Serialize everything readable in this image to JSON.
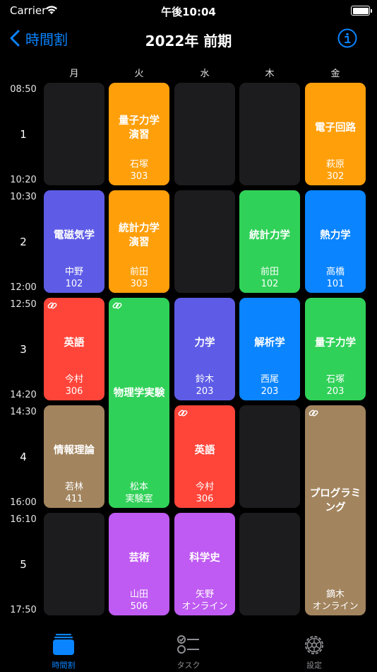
{
  "status": {
    "carrier": "Carrier",
    "time": "午後10:04"
  },
  "nav": {
    "back_label": "時間割",
    "title": "2022年 前期"
  },
  "days": [
    "月",
    "火",
    "水",
    "木",
    "金"
  ],
  "periods": [
    {
      "num": "1",
      "start": "08:50",
      "end": "10:20"
    },
    {
      "num": "2",
      "start": "10:30",
      "end": "12:00"
    },
    {
      "num": "3",
      "start": "12:50",
      "end": "14:20"
    },
    {
      "num": "4",
      "start": "14:30",
      "end": "16:00"
    },
    {
      "num": "5",
      "start": "16:10",
      "end": "17:50"
    }
  ],
  "colors": {
    "empty": "#1c1c1e",
    "orange": "#ff9f0a",
    "indigo": "#5e5ce6",
    "green": "#30d158",
    "blue": "#0a84ff",
    "red": "#ff453a",
    "brown": "#a2845e",
    "purple": "#bf5af2"
  },
  "cells": [
    {
      "day": 0,
      "period": 0,
      "span": 1,
      "color": "empty"
    },
    {
      "day": 1,
      "period": 0,
      "span": 1,
      "color": "orange",
      "subject": "量子力学\n演習",
      "teacher": "石塚",
      "room": "303"
    },
    {
      "day": 2,
      "period": 0,
      "span": 1,
      "color": "empty"
    },
    {
      "day": 3,
      "period": 0,
      "span": 1,
      "color": "empty"
    },
    {
      "day": 4,
      "period": 0,
      "span": 1,
      "color": "orange",
      "subject": "電子回路",
      "teacher": "萩原",
      "room": "302"
    },
    {
      "day": 0,
      "period": 1,
      "span": 1,
      "color": "indigo",
      "subject": "電磁気学",
      "teacher": "中野",
      "room": "102"
    },
    {
      "day": 1,
      "period": 1,
      "span": 1,
      "color": "orange",
      "subject": "統計力学\n演習",
      "teacher": "前田",
      "room": "303"
    },
    {
      "day": 2,
      "period": 1,
      "span": 1,
      "color": "empty"
    },
    {
      "day": 3,
      "period": 1,
      "span": 1,
      "color": "green",
      "subject": "統計力学",
      "teacher": "前田",
      "room": "102"
    },
    {
      "day": 4,
      "period": 1,
      "span": 1,
      "color": "blue",
      "subject": "熱力学",
      "teacher": "高橋",
      "room": "101"
    },
    {
      "day": 0,
      "period": 2,
      "span": 1,
      "color": "red",
      "subject": "英語",
      "teacher": "今村",
      "room": "306",
      "link": true
    },
    {
      "day": 1,
      "period": 2,
      "span": 2,
      "color": "green",
      "subject": "物理学実験",
      "teacher": "松本",
      "room": "実験室",
      "link": true
    },
    {
      "day": 2,
      "period": 2,
      "span": 1,
      "color": "indigo",
      "subject": "力学",
      "teacher": "鈴木",
      "room": "203"
    },
    {
      "day": 3,
      "period": 2,
      "span": 1,
      "color": "blue",
      "subject": "解析学",
      "teacher": "西尾",
      "room": "203"
    },
    {
      "day": 4,
      "period": 2,
      "span": 1,
      "color": "green",
      "subject": "量子力学",
      "teacher": "石塚",
      "room": "203"
    },
    {
      "day": 0,
      "period": 3,
      "span": 1,
      "color": "brown",
      "subject": "情報理論",
      "teacher": "若林",
      "room": "411"
    },
    {
      "day": 2,
      "period": 3,
      "span": 1,
      "color": "red",
      "subject": "英語",
      "teacher": "今村",
      "room": "306",
      "link": true
    },
    {
      "day": 3,
      "period": 3,
      "span": 1,
      "color": "empty"
    },
    {
      "day": 4,
      "period": 3,
      "span": 2,
      "color": "brown",
      "subject": "プログラミ\nング",
      "teacher": "鏑木",
      "room": "オンライン",
      "link": true
    },
    {
      "day": 0,
      "period": 4,
      "span": 1,
      "color": "empty"
    },
    {
      "day": 1,
      "period": 4,
      "span": 1,
      "color": "purple",
      "subject": "芸術",
      "teacher": "山田",
      "room": "506"
    },
    {
      "day": 2,
      "period": 4,
      "span": 1,
      "color": "purple",
      "subject": "科学史",
      "teacher": "矢野",
      "room": "オンライン"
    },
    {
      "day": 3,
      "period": 4,
      "span": 1,
      "color": "empty"
    }
  ],
  "tabs": [
    {
      "label": "時間割",
      "icon": "stack-icon",
      "active": true
    },
    {
      "label": "タスク",
      "icon": "checklist-icon",
      "active": false
    },
    {
      "label": "設定",
      "icon": "gear-icon",
      "active": false
    }
  ]
}
